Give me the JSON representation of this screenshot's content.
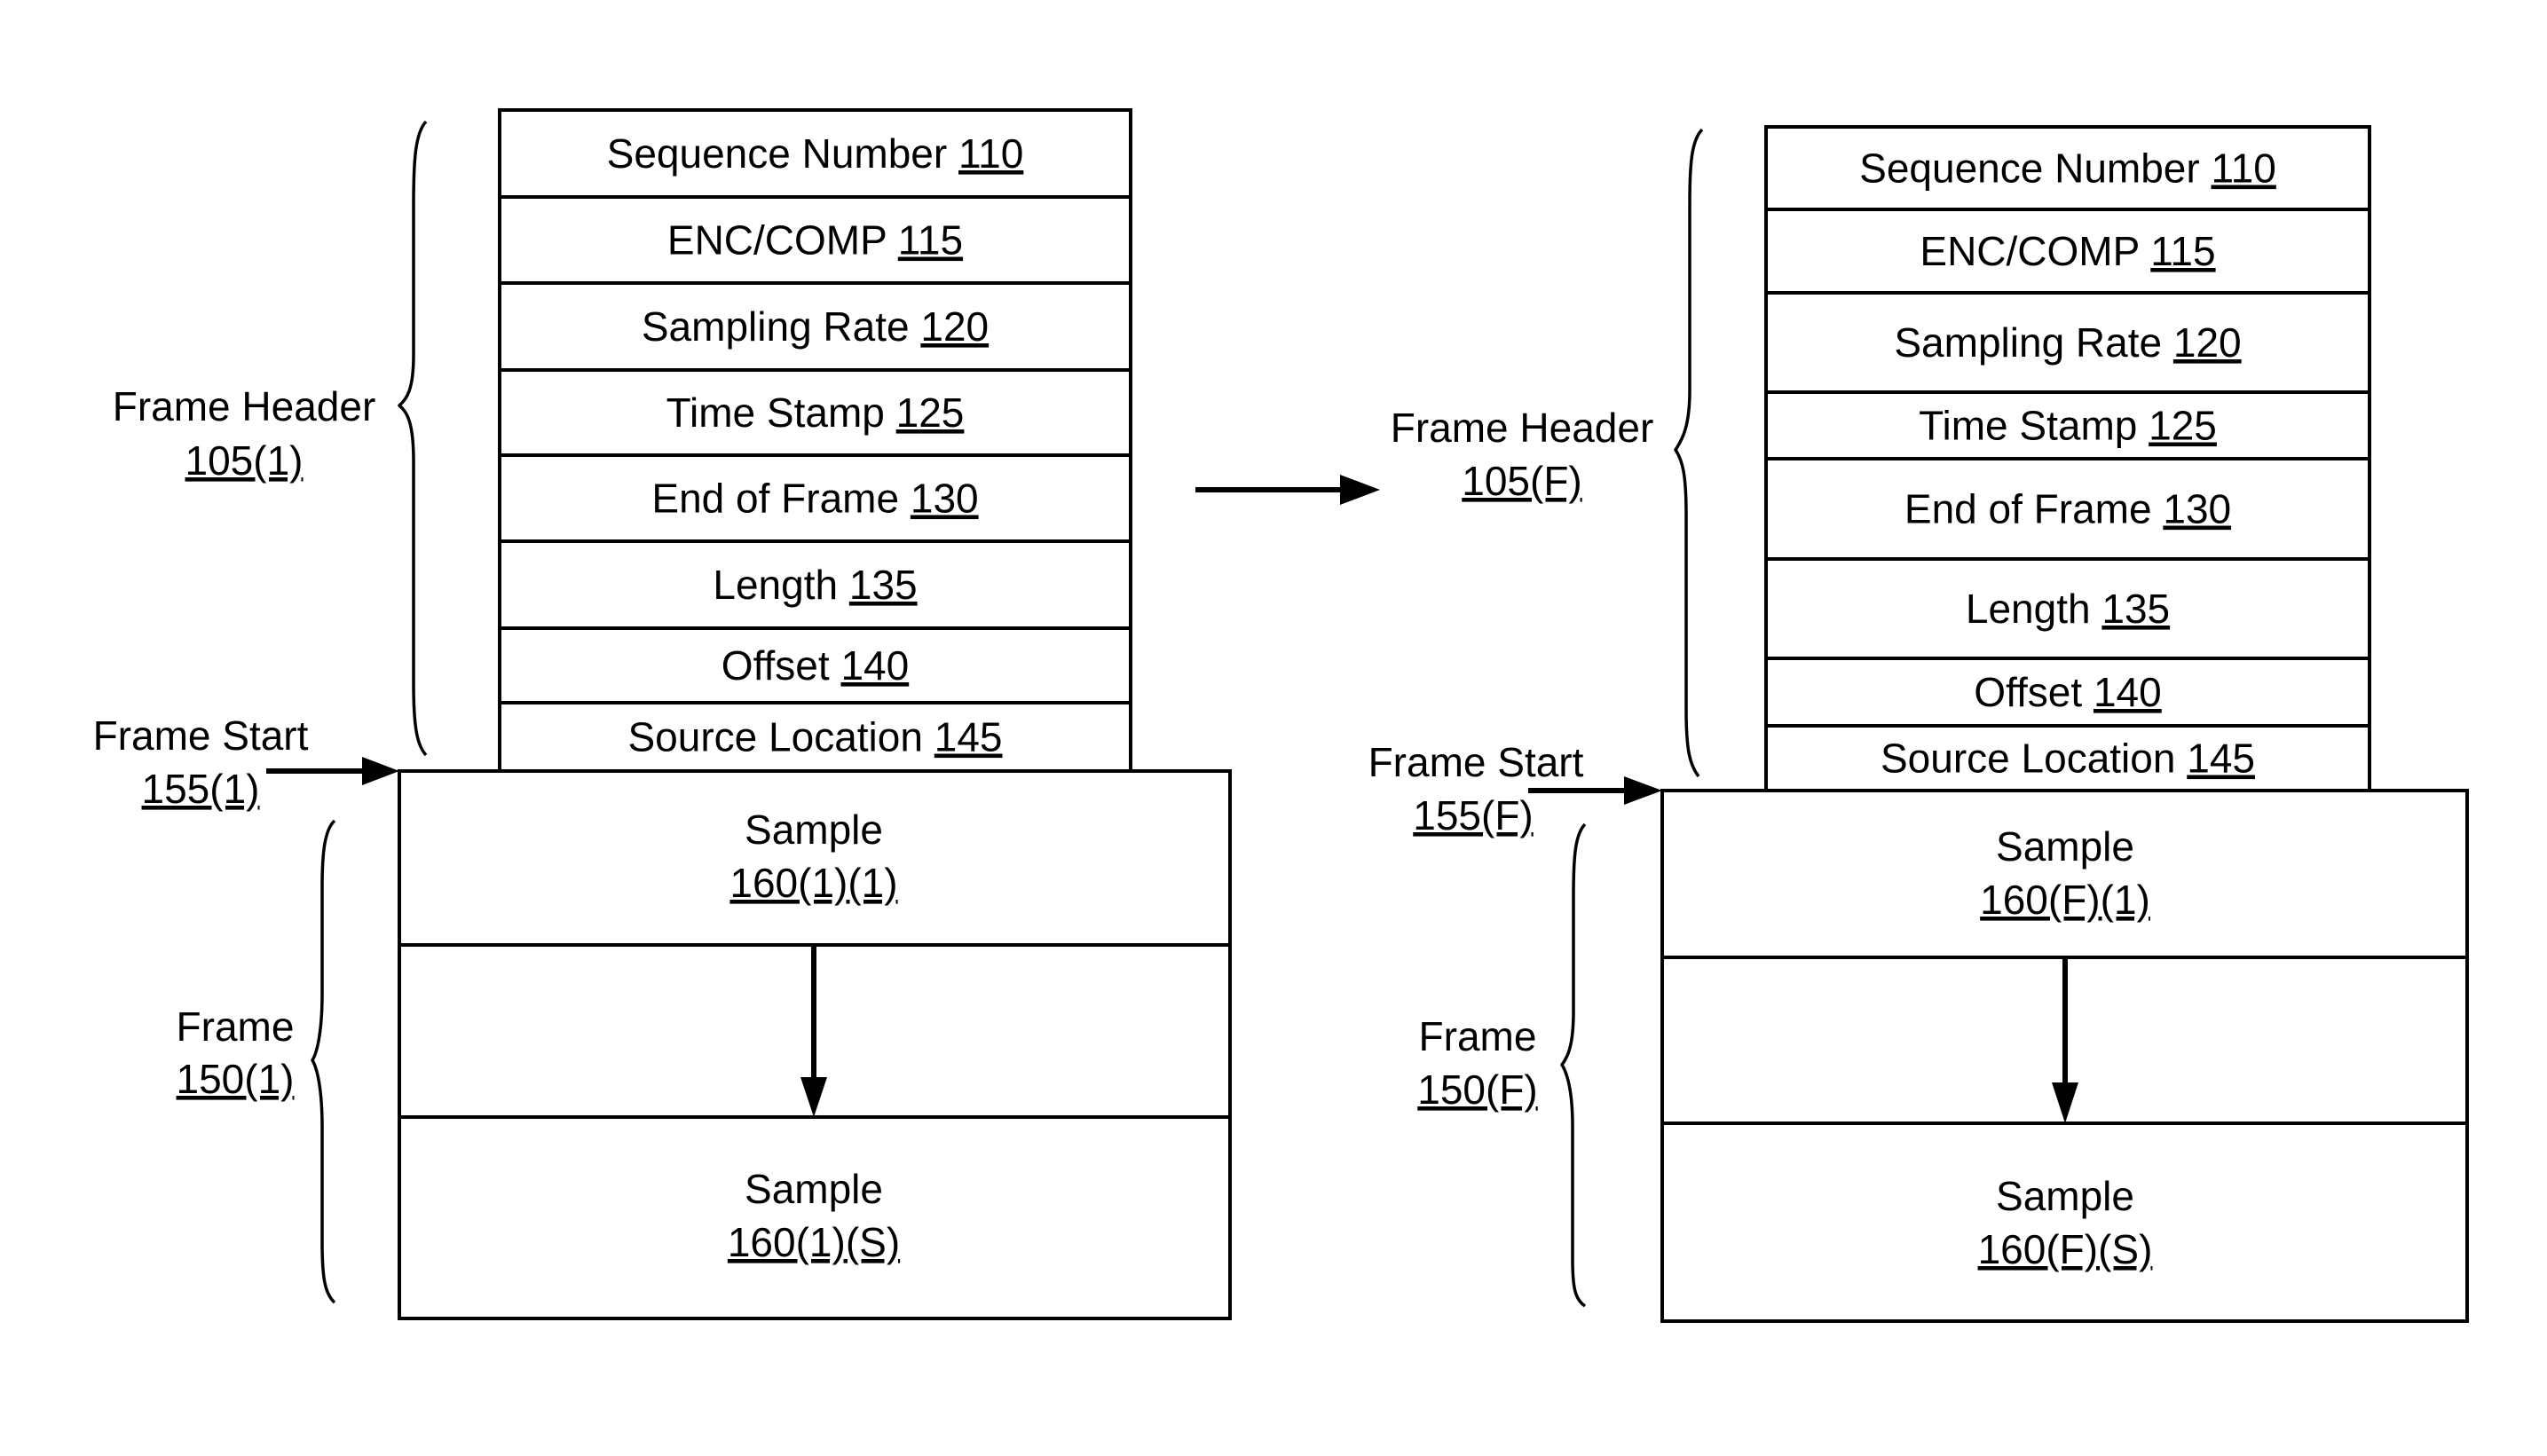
{
  "diagram": {
    "left": {
      "header_label": "Frame Header",
      "header_ref": "105(1)",
      "frame_start_label": "Frame Start",
      "frame_start_ref": "155(1)",
      "frame_label": "Frame",
      "frame_ref": "150(1)",
      "fields": [
        {
          "name": "Sequence Number",
          "ref": "110"
        },
        {
          "name": "ENC/COMP",
          "ref": "115"
        },
        {
          "name": "Sampling Rate",
          "ref": "120"
        },
        {
          "name": "Time Stamp",
          "ref": "125"
        },
        {
          "name": "End of Frame",
          "ref": "130"
        },
        {
          "name": "Length",
          "ref": "135"
        },
        {
          "name": "Offset",
          "ref": "140"
        },
        {
          "name": "Source Location",
          "ref": "145"
        }
      ],
      "samples": [
        {
          "name": "Sample",
          "ref": "160(1)(1)"
        },
        {
          "name": "Sample",
          "ref": "160(1)(S)"
        }
      ]
    },
    "right": {
      "header_label": "Frame Header",
      "header_ref": "105(F)",
      "frame_start_label": "Frame Start",
      "frame_start_ref": "155(F)",
      "frame_label": "Frame",
      "frame_ref": "150(F)",
      "fields": [
        {
          "name": "Sequence Number",
          "ref": "110"
        },
        {
          "name": "ENC/COMP",
          "ref": "115"
        },
        {
          "name": "Sampling Rate",
          "ref": "120"
        },
        {
          "name": "Time Stamp",
          "ref": "125"
        },
        {
          "name": "End of Frame",
          "ref": "130"
        },
        {
          "name": "Length",
          "ref": "135"
        },
        {
          "name": "Offset",
          "ref": "140"
        },
        {
          "name": "Source Location",
          "ref": "145"
        }
      ],
      "samples": [
        {
          "name": "Sample",
          "ref": "160(F)(1)"
        },
        {
          "name": "Sample",
          "ref": "160(F)(S)"
        }
      ]
    }
  }
}
